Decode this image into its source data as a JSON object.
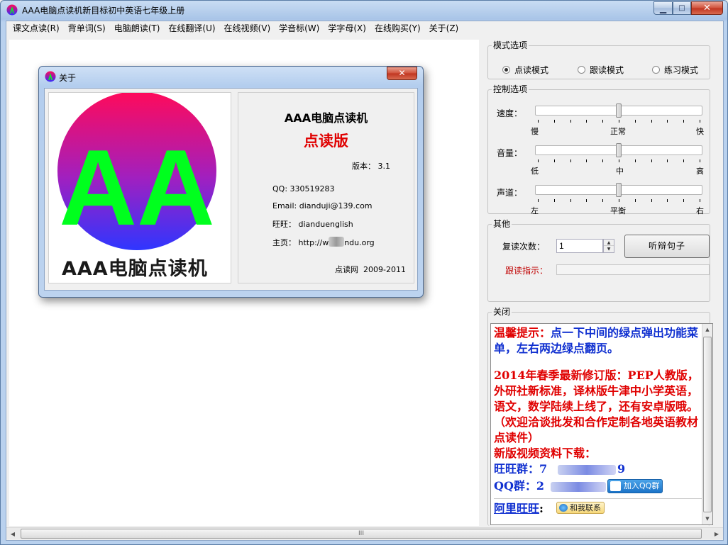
{
  "window": {
    "title": "AAA电脑点读机新目标初中英语七年级上册",
    "minimize": "▁",
    "maximize": "□",
    "close": "✕"
  },
  "menu": [
    "课文点读(R)",
    "背单词(S)",
    "电脑朗读(T)",
    "在线翻译(U)",
    "在线视频(V)",
    "学音标(W)",
    "学字母(X)",
    "在线购买(Y)",
    "关于(Z)"
  ],
  "mode": {
    "title": "模式选项",
    "options": [
      "点读模式",
      "跟读模式",
      "练习模式"
    ],
    "selected_index": 0
  },
  "control": {
    "title": "控制选项",
    "speed": {
      "label": "速度：",
      "left": "慢",
      "center": "正常",
      "right": "快",
      "level": 0.5
    },
    "volume": {
      "label": "音量：",
      "left": "低",
      "center": "中",
      "right": "高",
      "level": 0.5
    },
    "channel": {
      "label": "声道：",
      "left": "左",
      "center": "平衡",
      "right": "右",
      "level": 0.5
    }
  },
  "other": {
    "title": "其他",
    "repeat_label": "复读次数：",
    "repeat_value": "1",
    "listen_button": "听辩句子",
    "follow_indicator": "跟读指示："
  },
  "close_section": {
    "title": "关闭",
    "tip_label": "温馨提示：",
    "tip_text": "点一下中间的绿点弹出功能菜单，左右两边绿点翻页。",
    "news": "2014年春季最新修订版：PEP人教版，外研社新标准，译林版牛津中小学英语，语文，数学陆续上线了，还有安卓版哦。（欢迎洽谈批发和合作定制各地英语教材点读件）",
    "video_title": "新版视频资料下载：",
    "wangwang_group": "旺旺群：7",
    "wangwang_group_tail": "9",
    "qq_group": "QQ群：2",
    "join_qq": "加入QQ群",
    "ali_label": "阿里旺旺",
    "contact_me": "和我联系"
  },
  "scrollbar": {
    "grip": "III"
  },
  "about": {
    "title": "关于",
    "close": "✕",
    "logo_letters": "AA",
    "logo_caption": "AAA电脑点读机",
    "product": "AAA电脑点读机",
    "edition": "点读版",
    "version": "版本：  3.1",
    "qq": "QQ:  330519283",
    "email": "Email:  dianduji@139.com",
    "wangwang": "旺旺：   dianduenglish",
    "homepage_prefix": "主页：  http://w",
    "homepage_suffix": "ndu.org",
    "copyright_site": "点读网",
    "copyright_years": "2009-2011"
  },
  "colors": {
    "red_text": "#e00000",
    "blue_text": "#1030d0",
    "logo_green": "#00ff1e",
    "logo_top": "#ff0a5a",
    "logo_bottom": "#3030ff"
  }
}
